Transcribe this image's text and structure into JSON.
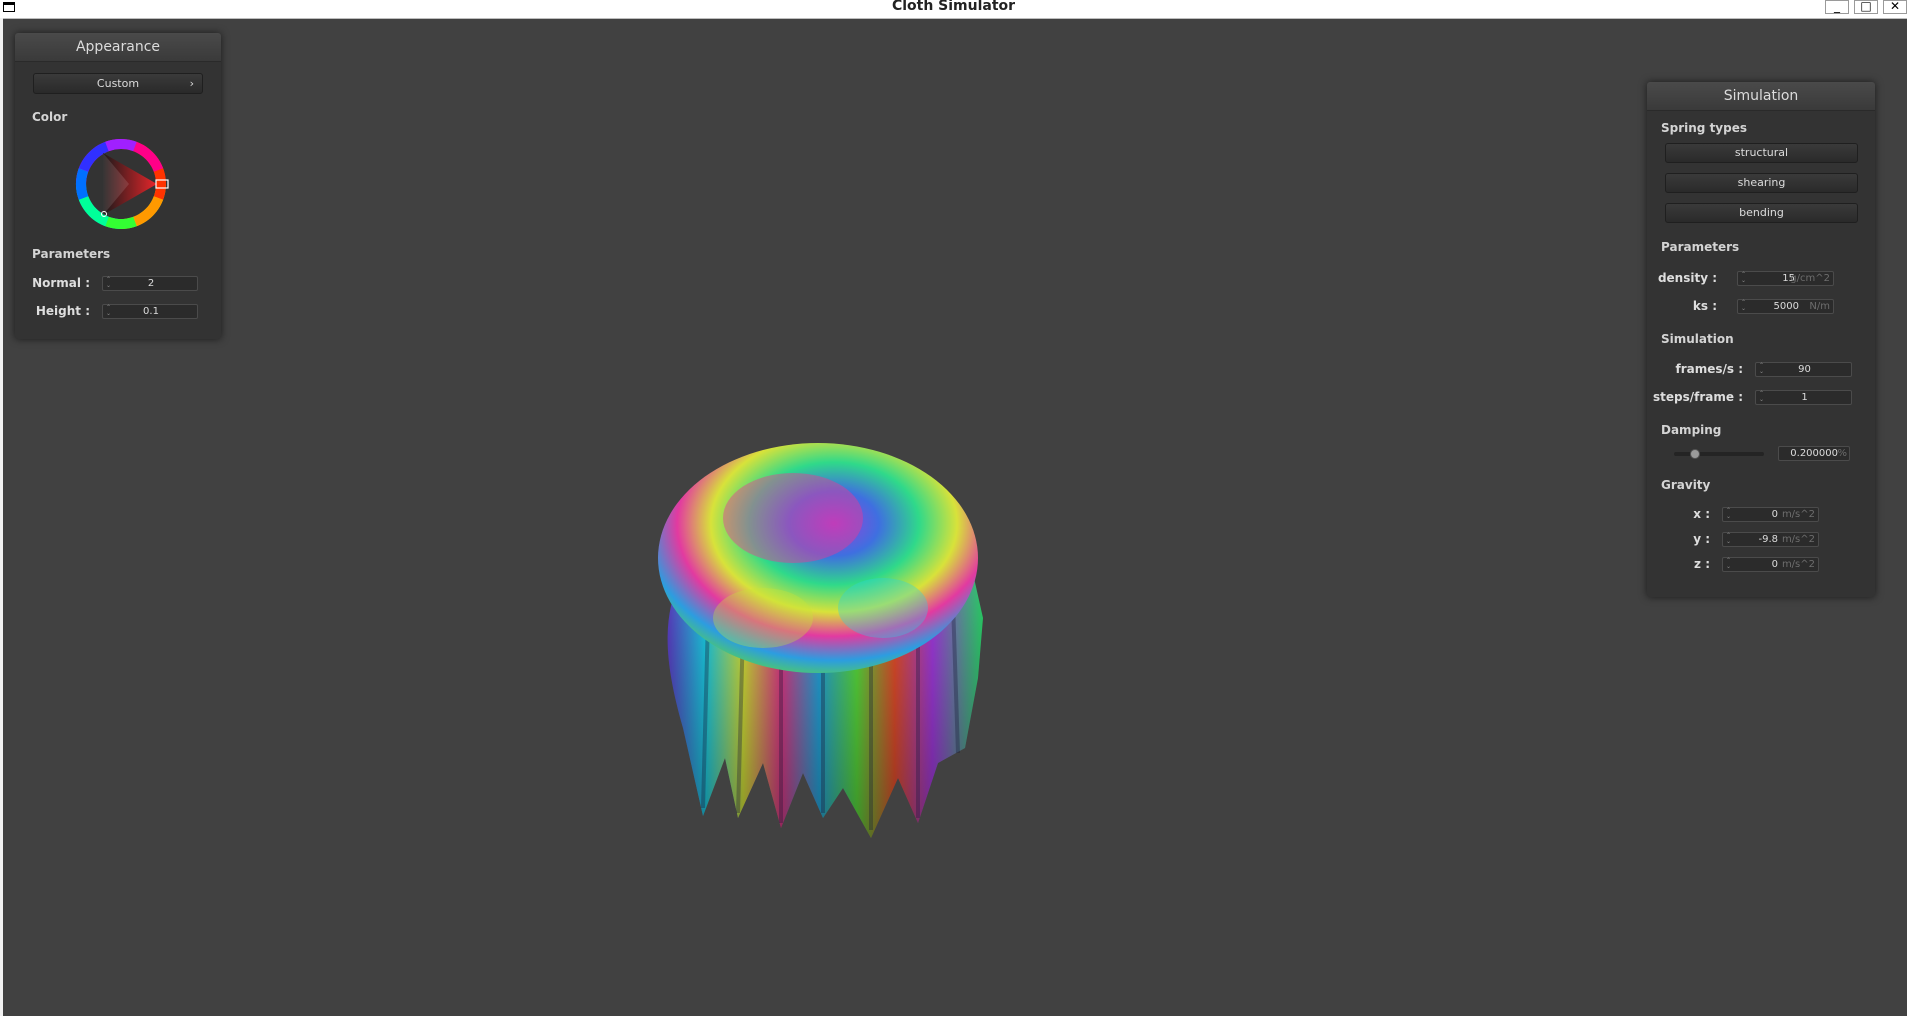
{
  "window": {
    "title": "Cloth Simulator",
    "buttons": {
      "minimize": "_",
      "maximize": "□",
      "close": "✕"
    }
  },
  "appearance": {
    "title": "Appearance",
    "shader_select": "Custom",
    "shader_chevron": "›",
    "color_label": "Color",
    "selected_color": "#e8262b",
    "parameters_label": "Parameters",
    "normal_label": "Normal :",
    "normal_value": "2",
    "height_label": "Height :",
    "height_value": "0.1"
  },
  "simulation": {
    "title": "Simulation",
    "spring_types_label": "Spring types",
    "spring_buttons": [
      "structural",
      "shearing",
      "bending"
    ],
    "parameters_label": "Parameters",
    "density_label": "density :",
    "density_value": "15",
    "density_unit": "g/cm^2",
    "ks_label": "ks :",
    "ks_value": "5000",
    "ks_unit": "N/m",
    "simulation_label": "Simulation",
    "fps_label": "frames/s :",
    "fps_value": "90",
    "steps_label": "steps/frame :",
    "steps_value": "1",
    "damping_label": "Damping",
    "damping_slider_fraction": 0.2,
    "damping_value": "0.200000",
    "damping_unit": "%",
    "gravity_label": "Gravity",
    "gx_label": "x :",
    "gx_value": "0",
    "gy_label": "y :",
    "gy_value": "-9.8",
    "gz_label": "z :",
    "gz_value": "0",
    "gravity_unit": "m/s^2"
  },
  "spin_arrows": {
    "up": "⌃",
    "down": "⌄"
  }
}
